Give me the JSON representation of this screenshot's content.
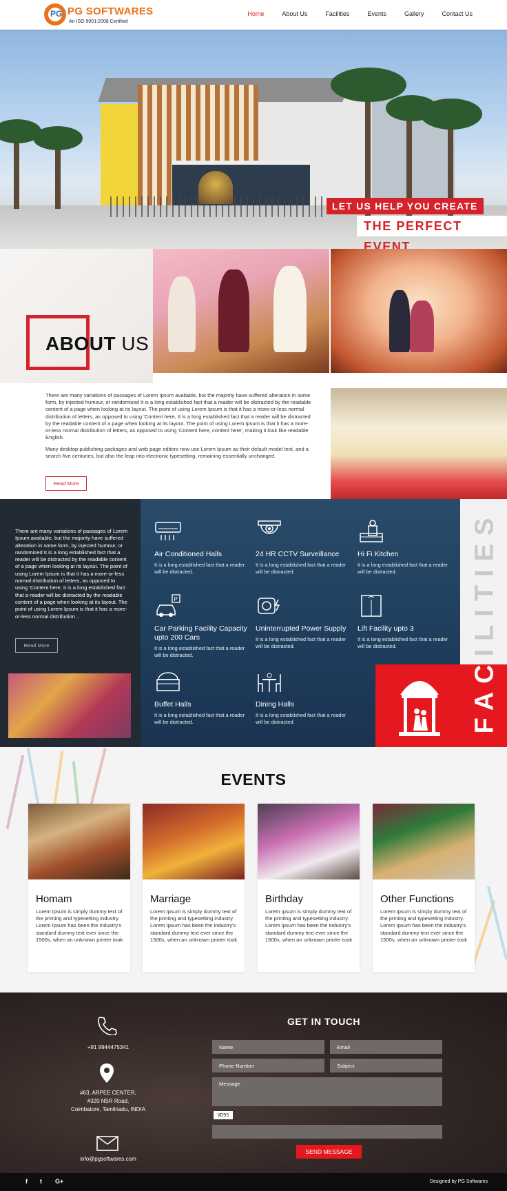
{
  "brand": {
    "logo_letters": "PG",
    "name": "PG SOFTWARES",
    "tagline": "An ISO 9001:2008 Certified"
  },
  "nav": {
    "items": [
      {
        "label": "Home",
        "active": true
      },
      {
        "label": "About Us",
        "active": false
      },
      {
        "label": "Facilities",
        "active": false
      },
      {
        "label": "Events",
        "active": false
      },
      {
        "label": "Gallery",
        "active": false
      },
      {
        "label": "Contact Us",
        "active": false
      }
    ]
  },
  "hero": {
    "tagline_line1": "LET US HELP YOU CREATE",
    "tagline_line2": "THE PERFECT EVENT."
  },
  "about": {
    "title_bold": "ABOUT",
    "title_light": "US",
    "paragraph1": "There are many variations of passages of Lorem Ipsum available, but the majority have suffered alteration in some form, by injected humour, or randomised It is a long established fact that a reader will be distracted by the readable content of a page when looking at its layout. The point of using Lorem Ipsum is that it has a more-or-less normal distribution of letters, as opposed to using 'Content here, It is a long established fact that a reader will be distracted by the readable content of a page when looking at its layout. The point of using Lorem Ipsum is that it has a more-or-less normal distribution of letters, as opposed to using 'Content here, content here', making it look like readable English.",
    "paragraph2": "Many desktop publishing packages and web page editors now use Lorem Ipsum as their default model text, and a search five centuries, but also the leap into electronic typesetting, remaining essentially unchanged.",
    "read_more": "Read More"
  },
  "facilities": {
    "intro": "There are many variations of passages of Lorem Ipsum available, but the majority have suffered alteration in some form, by injected humour, or randomised It is a long established fact that a reader will be distracted by the readable content of a page when looking at its layout. The point of using Lorem Ipsum is that it has a more-or-less normal distribution of letters, as opposed to using 'Content here, It is a long established fact that a reader will be distracted by the readable content of a page when looking at its layout. The point of using Lorem Ipsum is that it has a more-or-less normal distribution ..",
    "read_more": "Read More",
    "word": "FACILITIES",
    "items": [
      {
        "icon": "air-conditioner-icon",
        "title": "Air Conditioned Halls",
        "desc": "It is a long established fact that a reader will be distracted."
      },
      {
        "icon": "cctv-icon",
        "title": "24 HR CCTV Surveillance",
        "desc": "It is a long established fact that a reader will be distracted."
      },
      {
        "icon": "kitchen-icon",
        "title": "Hi Fi Kitchen",
        "desc": "It is a long established fact that a reader will be distracted."
      },
      {
        "icon": "car-parking-icon",
        "title": "Car Parking Facility Capacity upto 200 Cars",
        "desc": "It is a long established fact that a reader will be distracted."
      },
      {
        "icon": "generator-icon",
        "title": "Uninterrupted Power Supply",
        "desc": "It is a long established fact that a reader will be distracted."
      },
      {
        "icon": "lift-icon",
        "title": "Lift Facility upto 3",
        "desc": "It is a long established fact that a reader will be distracted."
      },
      {
        "icon": "buffet-icon",
        "title": "Buffet Halls",
        "desc": "It is a long established fact that a reader will be distracted."
      },
      {
        "icon": "dining-icon",
        "title": "Dining Halls",
        "desc": "It is a long established fact that a reader will be distracted."
      }
    ]
  },
  "events": {
    "title": "EVENTS",
    "cards": [
      {
        "title": "Homam",
        "desc": "Lorem Ipsum is simply dummy text of the printing and typesetting industry. Lorem Ipsum has been the industry's standard dummy text ever since the 1500s, when an unknown printer took"
      },
      {
        "title": "Marriage",
        "desc": "Lorem Ipsum is simply dummy text of the printing and typesetting industry. Lorem Ipsum has been the industry's standard dummy text ever since the 1500s, when an unknown printer took"
      },
      {
        "title": "Birthday",
        "desc": "Lorem Ipsum is simply dummy text of the printing and typesetting industry. Lorem Ipsum has been the industry's standard dummy text ever since the 1500s, when an unknown printer took"
      },
      {
        "title": "Other Functions",
        "desc": "Lorem Ipsum is simply dummy text of the printing and typesetting industry. Lorem Ipsum has been the industry's standard dummy text ever since the 1500s, when an unknown printer took"
      }
    ]
  },
  "contact": {
    "phone": "+91 9944475341",
    "address_line1": "#63, ARPEE CENTER,",
    "address_line2": "#320 NSR Road,",
    "address_line3": "Coimbatore, Tamilnadu, INDIA",
    "email": "info@pgsoftwares.com",
    "form_title": "GET IN TOUCH",
    "name_placeholder": "Name",
    "email_placeholder": "Email",
    "phone_placeholder": "Phone Number",
    "subject_placeholder": "Subject",
    "message_placeholder": "Message",
    "captcha_text": "VD9S",
    "send_label": "SEND MESSAGE"
  },
  "footer": {
    "social": [
      "f",
      "t",
      "G+"
    ],
    "credit": "Designed by PG Softwares"
  },
  "colors": {
    "accent_red": "#e4181e",
    "brand_orange": "#e8731a",
    "facilities_blue": "#1e3d5c"
  }
}
